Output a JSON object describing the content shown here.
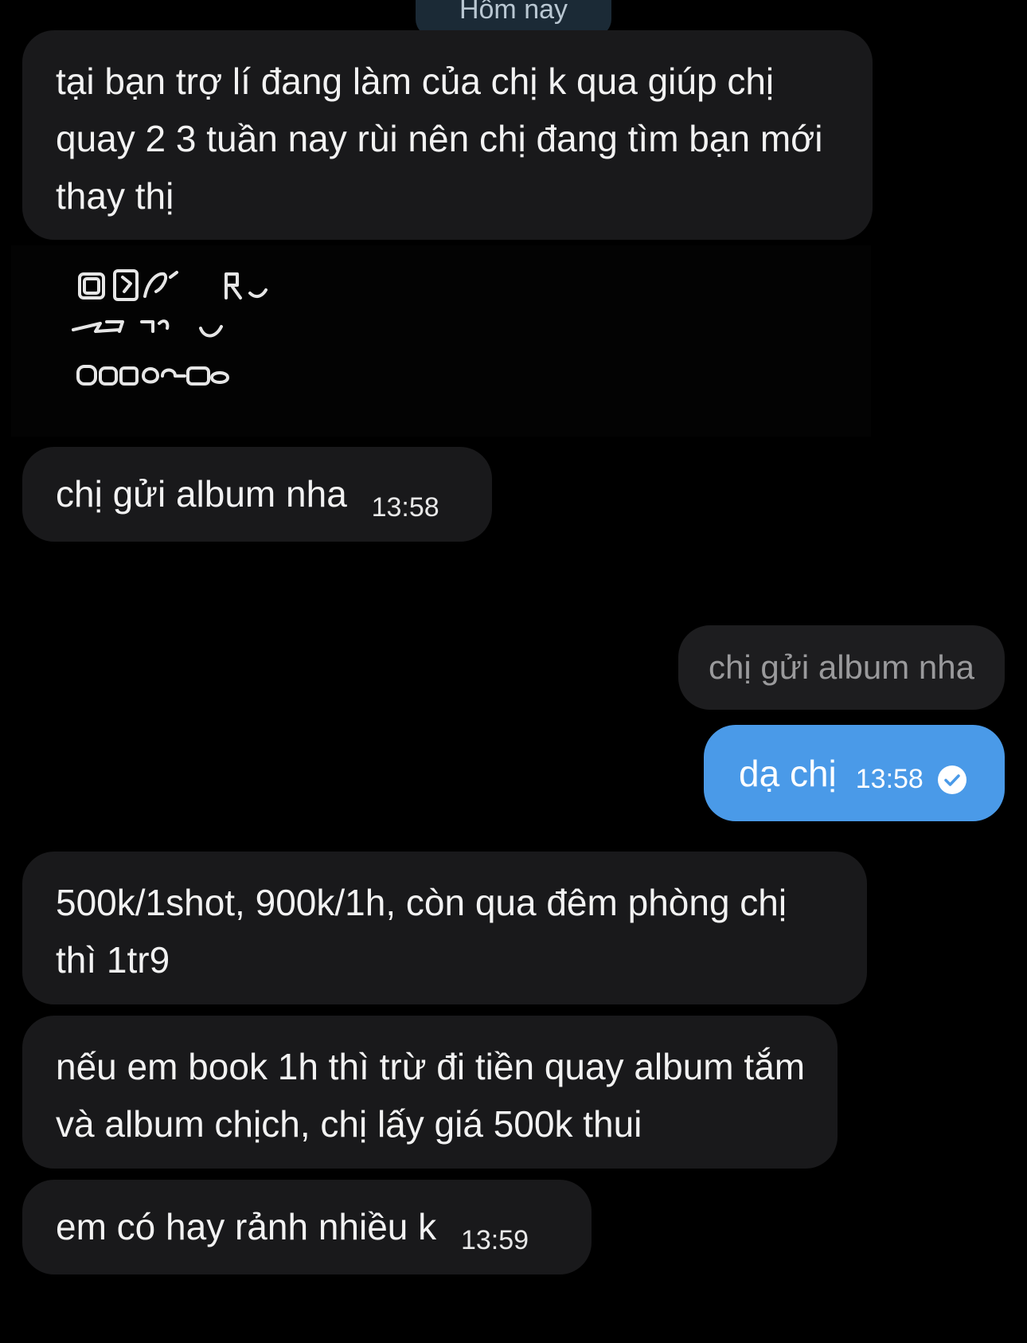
{
  "date_divider": "Hôm nay",
  "messages": [
    {
      "text": "tại bạn trợ lí đang làm của chị k qua giúp chị quay 2 3 tuần nay rùi nên chị đang tìm bạn mới thay thị"
    },
    {
      "text": "chị gửi album nha",
      "time": "13:58"
    },
    {
      "quoted": "chị gửi album nha"
    },
    {
      "text": "dạ chị",
      "time": "13:58",
      "status_icon": "check-circle-icon"
    },
    {
      "text": "500k/1shot, 900k/1h, còn qua đêm phòng chị thì 1tr9"
    },
    {
      "text": "nếu em book 1h thì trừ đi tiền quay album tắm và album chịch, chị lấy giá 500k thui"
    },
    {
      "text": "em có hay rảnh nhiều k",
      "time": "13:59"
    }
  ],
  "colors": {
    "background": "#000000",
    "incoming_bubble": "#19191b",
    "outgoing_bubble": "#4a9ae8",
    "quote_bubble": "#1d1d1f"
  }
}
